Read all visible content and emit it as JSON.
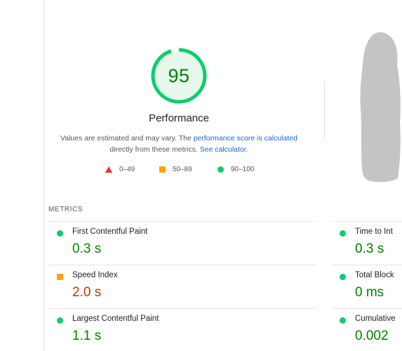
{
  "score": {
    "value": "95",
    "fraction": 0.95,
    "color": "#0cce6b",
    "text_color": "#008000",
    "fill": "#e6f8ec"
  },
  "category": {
    "title": "Performance"
  },
  "description": {
    "text_before": "Values are estimated and may vary. The ",
    "link1": "performance score is calculated",
    "text_middle": " directly from these metrics. ",
    "link2": "See calculator."
  },
  "legend": [
    {
      "icon": "triangle",
      "label": "0–49",
      "color": "#ff2c1f"
    },
    {
      "icon": "square",
      "label": "50–89",
      "color": "#ffa400"
    },
    {
      "icon": "circle",
      "label": "90–100",
      "color": "#0cce6b"
    }
  ],
  "metrics": {
    "heading": "METRICS",
    "left": [
      {
        "name": "First Contentful Paint",
        "value": "0.3 s",
        "status": "pass"
      },
      {
        "name": "Speed Index",
        "value": "2.0 s",
        "status": "average"
      },
      {
        "name": "Largest Contentful Paint",
        "value": "1.1 s",
        "status": "pass"
      }
    ],
    "right": [
      {
        "name": "Time to Int",
        "value": "0.3 s",
        "status": "pass"
      },
      {
        "name": "Total Block",
        "value": "0 ms",
        "status": "pass"
      },
      {
        "name": "Cumulative",
        "value": "0.002",
        "status": "pass"
      }
    ]
  }
}
